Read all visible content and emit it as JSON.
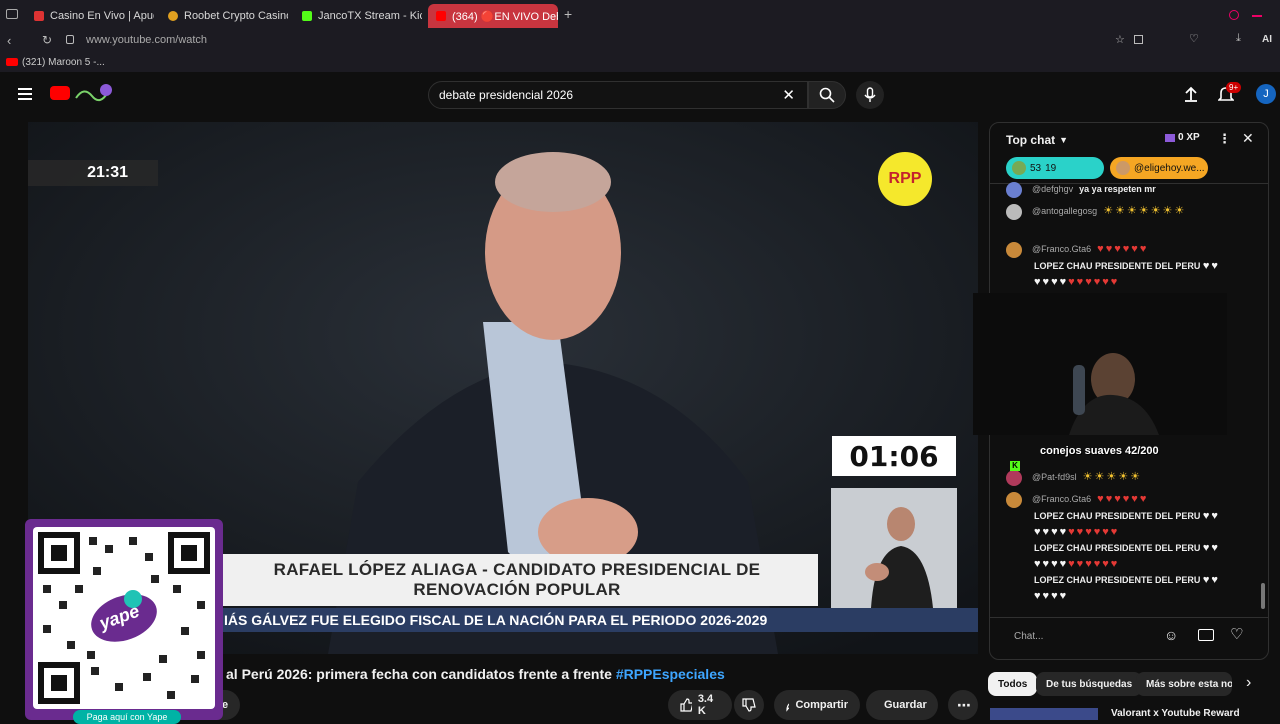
{
  "browser": {
    "tabs": [
      {
        "label": "Casino En Vivo | Apuesta"
      },
      {
        "label": "Roobet Crypto Casino | Be"
      },
      {
        "label": "JancoTX Stream - Kick De"
      },
      {
        "label": "(364) 🔴EN VIVO Deb"
      }
    ],
    "url": "www.youtube.com/watch",
    "bookmark": "(321) Maroon 5 -...",
    "ai_label": "AI"
  },
  "header": {
    "search_value": "debate presidencial 2026",
    "notif_count": "9+",
    "avatar_letter": "J"
  },
  "video": {
    "timer_left": "21:31",
    "rpp_logo": "RPP",
    "countdown": "01:06",
    "lower_third_line1": "RAFAEL LÓPEZ ALIAGA - CANDIDATO PRESIDENCIAL DE",
    "lower_third_line2": "RENOVACIÓN POPULAR",
    "ticker": "IÁS GÁLVEZ FUE ELEGIDO FISCAL DE LA NACIÓN PARA EL PERIODO 2026-2029"
  },
  "title": {
    "text": "al Perú 2026: primera fecha con candidatos frente a frente ",
    "hashtag": "#RPPEspeciales"
  },
  "actions": {
    "likes": "3.4 K",
    "share": "Compartir",
    "save": "Guardar",
    "partial": "e"
  },
  "qr": {
    "brand": "yape",
    "footer": "Paga aquí con Yape"
  },
  "chat": {
    "header": "Top chat",
    "xp": "0 XP",
    "pinned1_count": "53",
    "pinned1_members": "19",
    "pinned2_label": "@eligehoy.we...",
    "messages": [
      {
        "author": "@defghgv",
        "text": "ya ya respeten mr"
      },
      {
        "author": "@antogallegosg",
        "text": ""
      },
      {
        "author": "@Franco.Gta6",
        "text": "LOPEZ CHAU PRESIDENTE DEL PERU"
      },
      {
        "author": "@Pat-fd9sl",
        "text": ""
      },
      {
        "author": "@Franco.Gta6",
        "text": "LOPEZ CHAU PRESIDENTE DEL PERU"
      },
      {
        "author": "",
        "text": "LOPEZ CHAU PRESIDENTE DEL PERU"
      },
      {
        "author": "",
        "text": "LOPEZ CHAU PRESIDENTE DEL PERU"
      }
    ],
    "input_placeholder": "Chat..."
  },
  "overlay": {
    "cam_text": "conejos suaves 42/200",
    "cam_badge": "K"
  },
  "chips": [
    "Todos",
    "De tus búsquedas",
    "Más sobre esta not"
  ],
  "suggestion": "Valorant x Youtube Reward",
  "colors": {
    "accent_red": "#ff0000",
    "link_blue": "#3ea6ff",
    "yape_purple": "#6a2b8f",
    "rpp_yellow": "#f5e82c"
  }
}
